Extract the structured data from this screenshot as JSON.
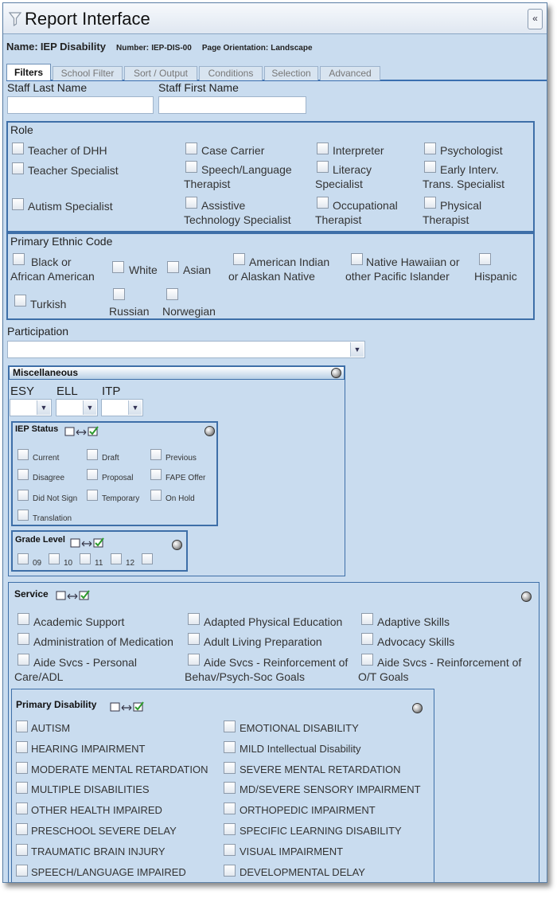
{
  "window": {
    "title": "Report Interface",
    "collapse_label": "«"
  },
  "report": {
    "name_label": "Name:",
    "name_value": "IEP Disability",
    "number_label": "Number:",
    "number_value": "IEP-DIS-00",
    "orientation_label": "Page Orientation:",
    "orientation_value": "Landscape"
  },
  "tabs": [
    "Filters",
    "School Filter",
    "Sort / Output",
    "Conditions",
    "Selection",
    "Advanced"
  ],
  "staff": {
    "last_name_label": "Staff Last Name",
    "first_name_label": "Staff First Name",
    "last_name_value": "",
    "first_name_value": ""
  },
  "role": {
    "title": "Role",
    "options": [
      [
        "Teacher of DHH"
      ],
      [
        "Case Carrier"
      ],
      [
        "Interpreter"
      ],
      [
        "Psychologist"
      ],
      [
        "Teacher Specialist"
      ],
      [
        "Speech/Language",
        "Therapist"
      ],
      [
        "Literacy",
        "Specialist"
      ],
      [
        "Early Interv.",
        "Trans. Specialist"
      ],
      [
        "Autism Specialist"
      ],
      [
        "Assistive",
        "Technology Specialist"
      ],
      [
        "Occupational",
        "Therapist"
      ],
      [
        "Physical",
        "Therapist"
      ]
    ]
  },
  "ethnic": {
    "title": "Primary Ethnic Code",
    "options": [
      [
        "Black or",
        "African American"
      ],
      [
        "White"
      ],
      [
        "Asian"
      ],
      [
        "American Indian",
        "or Alaskan Native"
      ],
      [
        "Native Hawaiian or",
        "other Pacific Islander"
      ],
      [
        "Hispanic"
      ],
      [
        "Turkish"
      ],
      [
        "Russian"
      ],
      [
        "Norwegian"
      ]
    ]
  },
  "participation": {
    "label": "Participation",
    "value": ""
  },
  "misc": {
    "title": "Miscellaneous",
    "dropdowns": [
      "ESY",
      "ELL",
      "ITP"
    ],
    "iep_status": {
      "title": "IEP Status",
      "options": [
        "Current",
        "Draft",
        "Previous",
        "Disagree",
        "Proposal",
        "FAPE Offer",
        "Did Not Sign",
        "Temporary",
        "On Hold",
        "Translation"
      ]
    },
    "grade_level": {
      "title": "Grade Level",
      "options": [
        "09",
        "10",
        "11",
        "12",
        ""
      ]
    }
  },
  "service": {
    "title": "Service",
    "options": [
      [
        "Academic Support"
      ],
      [
        "Adapted Physical Education"
      ],
      [
        "Adaptive Skills"
      ],
      [
        "Administration of Medication"
      ],
      [
        "Adult Living Preparation"
      ],
      [
        "Advocacy Skills"
      ],
      [
        "Aide Svcs - Personal",
        "Care/ADL"
      ],
      [
        "Aide Svcs - Reinforcement of",
        "Behav/Psych-Soc Goals"
      ],
      [
        "Aide Svcs - Reinforcement of",
        "O/T Goals"
      ]
    ]
  },
  "disability": {
    "title": "Primary Disability",
    "left": [
      "AUTISM",
      "HEARING IMPAIRMENT",
      "MODERATE MENTAL RETARDATION",
      "MULTIPLE DISABILITIES",
      "OTHER HEALTH IMPAIRED",
      "PRESCHOOL SEVERE DELAY",
      "TRAUMATIC BRAIN INJURY",
      "SPEECH/LANGUAGE IMPAIRED"
    ],
    "right": [
      "EMOTIONAL DISABILITY",
      "MILD Intellectual Disability",
      "SEVERE MENTAL RETARDATION",
      "MD/SEVERE SENSORY IMPAIRMENT",
      "ORTHOPEDIC IMPAIRMENT",
      "SPECIFIC LEARNING DISABILITY",
      "VISUAL IMPAIRMENT",
      "DEVELOPMENTAL DELAY"
    ]
  },
  "icons": {
    "filter": "filter-icon",
    "collapse": "double-chevron-left-icon",
    "toggle": "circle-button-icon",
    "select_all": "select-all-icon"
  },
  "colors": {
    "panel": "#c9dcef",
    "border": "#3e6fa8",
    "tab_underline": "#3a6fb0"
  }
}
